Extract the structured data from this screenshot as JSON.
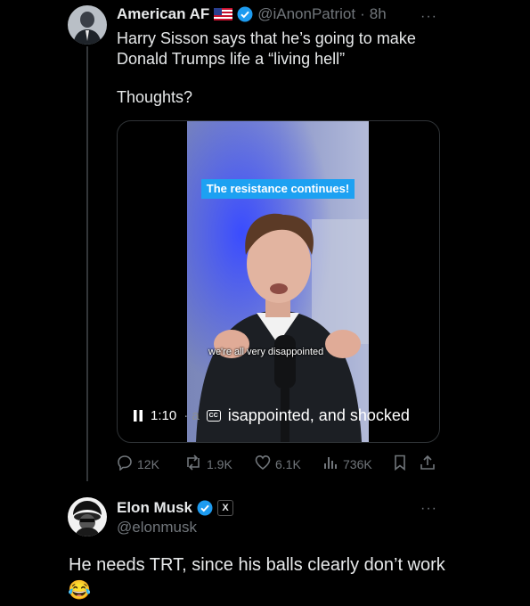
{
  "post": {
    "author_name": "American AF",
    "flag_icon": "us-flag-icon",
    "handle": "@iAnonPatriot",
    "separator": "·",
    "time": "8h",
    "text_line1": "Harry Sisson says that he’s going to make",
    "text_line2": "Donald Trumps life a “living hell”",
    "text_line3": "Thoughts?",
    "more": "···",
    "video": {
      "banner": "The resistance continues!",
      "burned_subtitle": "we're all very disappointed",
      "time": "1:10",
      "cc_label": "CC",
      "caption": "isappointed, and shocked",
      "caption_ghost": "disappointed, and shocked"
    },
    "stats": {
      "replies": "12K",
      "reposts": "1.9K",
      "likes": "6.1K",
      "views": "736K"
    }
  },
  "reply": {
    "author_name": "Elon Musk",
    "handle": "@elonmusk",
    "x_badge": "X",
    "text": "He needs TRT, since his balls clearly don’t work",
    "emoji": "😂",
    "more": "···"
  },
  "colors": {
    "background": "#000000",
    "text": "#e7e9ea",
    "muted": "#71767b",
    "verified": "#1d9bf0",
    "banner": "#1da1f2"
  }
}
